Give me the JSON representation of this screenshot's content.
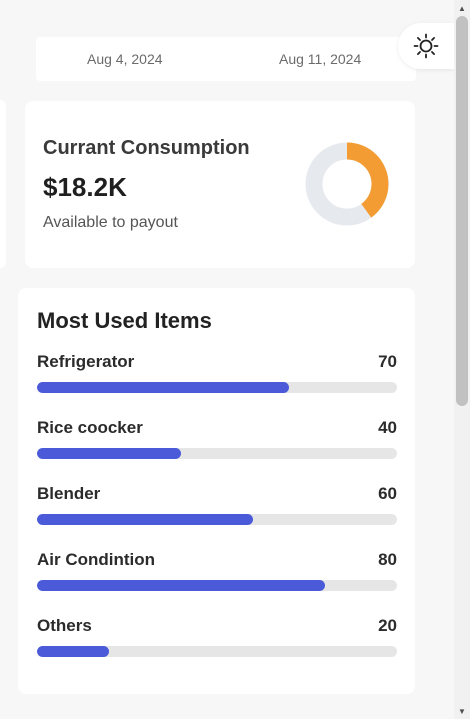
{
  "date_range": {
    "start": "Aug 4, 2024",
    "end": "Aug 11, 2024"
  },
  "theme_toggle": {
    "icon": "sun-icon"
  },
  "consumption": {
    "title": "Currant Consumption",
    "amount": "$18.2K",
    "subtitle": "Available to payout",
    "donut": {
      "fraction": 0.4,
      "fill_color": "#f39c34",
      "track_color": "#e6e9ee"
    }
  },
  "most_used": {
    "title": "Most Used Items",
    "bar_color": "#4a5ad9",
    "items": [
      {
        "label": "Refrigerator",
        "value": "70",
        "percent": 70
      },
      {
        "label": "Rice coocker",
        "value": "40",
        "percent": 40
      },
      {
        "label": "Blender",
        "value": "60",
        "percent": 60
      },
      {
        "label": "Air Condintion",
        "value": "80",
        "percent": 80
      },
      {
        "label": "Others",
        "value": "20",
        "percent": 20
      }
    ]
  }
}
